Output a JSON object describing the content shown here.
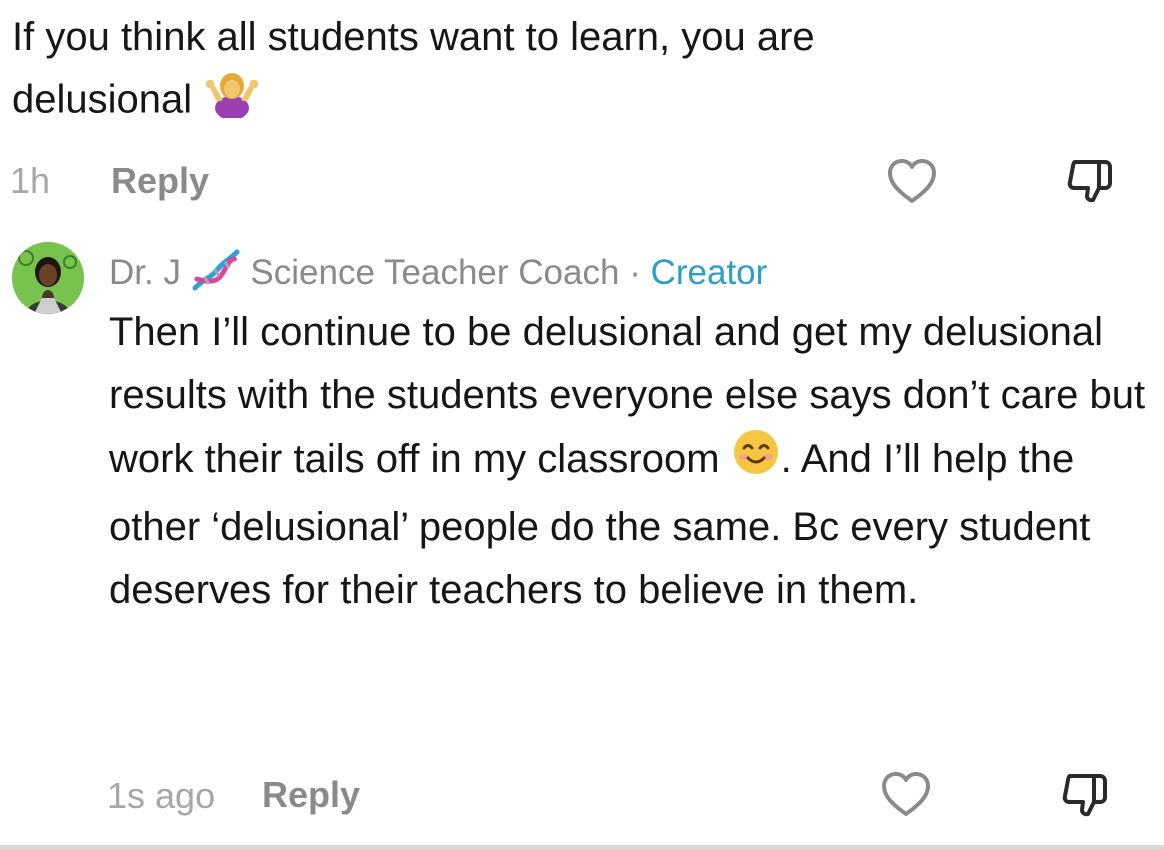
{
  "comments": [
    {
      "text_before_emoji": "If you think all students want to learn, you are delusional",
      "emoji": "person-shrugging",
      "time": "1h",
      "reply_label": "Reply"
    },
    {
      "author": "Dr. J",
      "author_emoji": "dna",
      "author_suffix": "Science Teacher Coach",
      "separator": "·",
      "creator_label": "Creator",
      "text_part1": "Then I’ll continue to be delusional and get my delusional results with the students everyone else says don’t care but work their tails off in my classroom",
      "emoji": "smiling-face",
      "text_part2": ". And I’ll help the other ‘delusional’ people do the same. Bc every student deserves for their teachers to believe in them.",
      "time": "1s ago",
      "reply_label": "Reply"
    }
  ],
  "icons": [
    "heart-icon",
    "dislike-icon"
  ],
  "colors": {
    "creator": "#2c9ec8",
    "meta": "#a7a7a7",
    "reply": "#8a8a8a",
    "text": "#161616"
  }
}
